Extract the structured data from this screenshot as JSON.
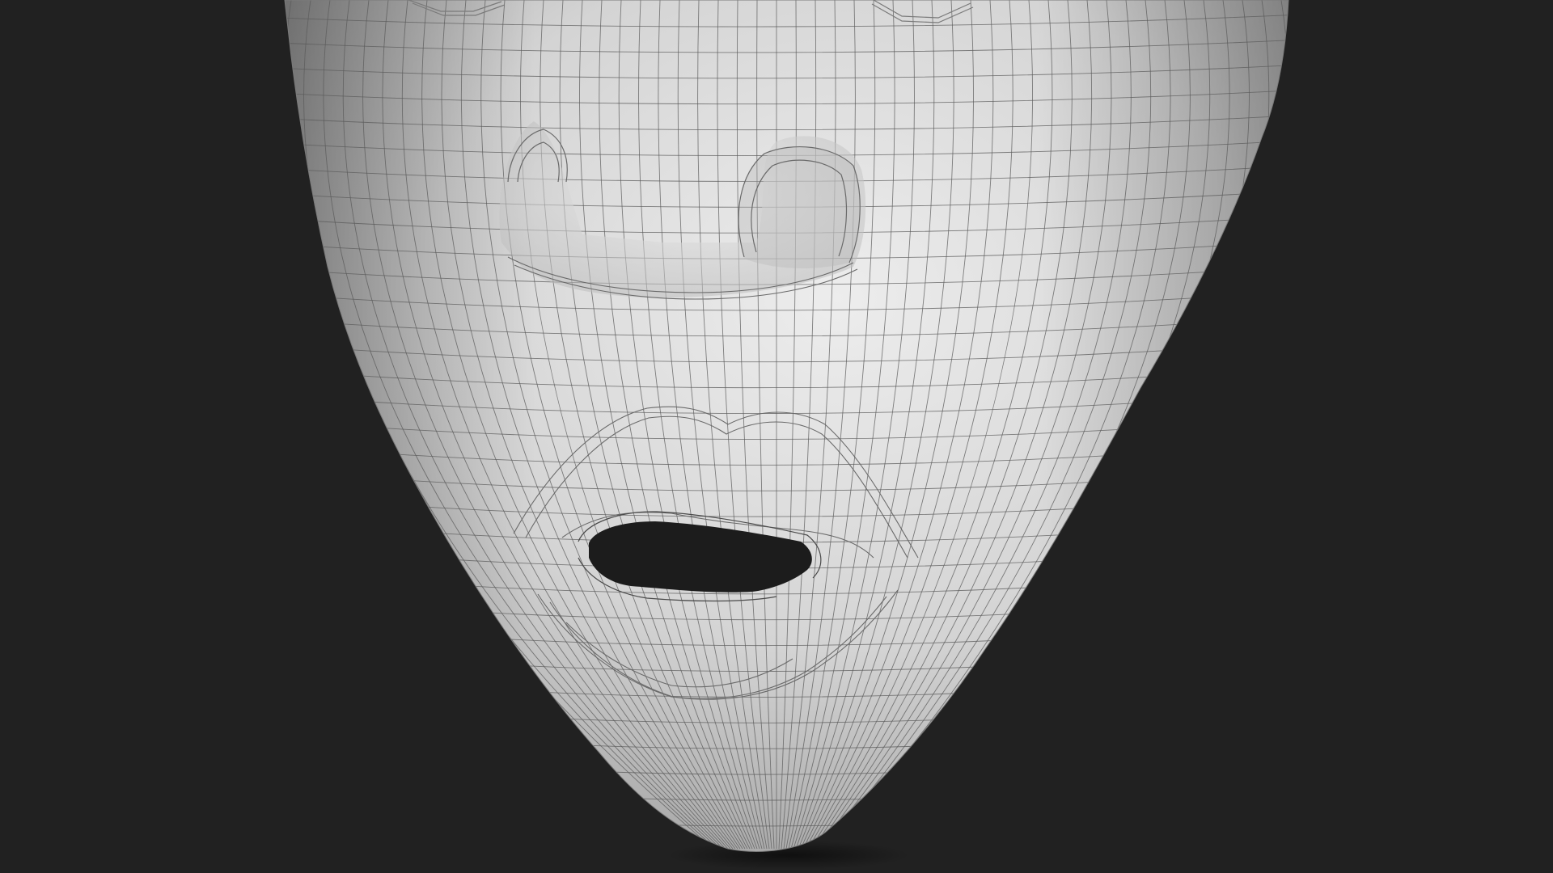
{
  "scene": {
    "subject": "face-mesh-lower-half",
    "render_style": "wireframe-on-clay",
    "visible_parts": [
      "brow-edge",
      "nose",
      "nostril-left",
      "nostril-right",
      "upper-lip",
      "mouth-opening",
      "lower-lip",
      "chin"
    ]
  },
  "colors": {
    "background": "#212121",
    "surface_light": "#ebebeb",
    "surface_mid": "#cfcfcf",
    "surface_dark": "#8f8f8f",
    "wire": "#5a5a5a",
    "mouth_interior": "#1c1c1c",
    "shadow": "#141414"
  }
}
